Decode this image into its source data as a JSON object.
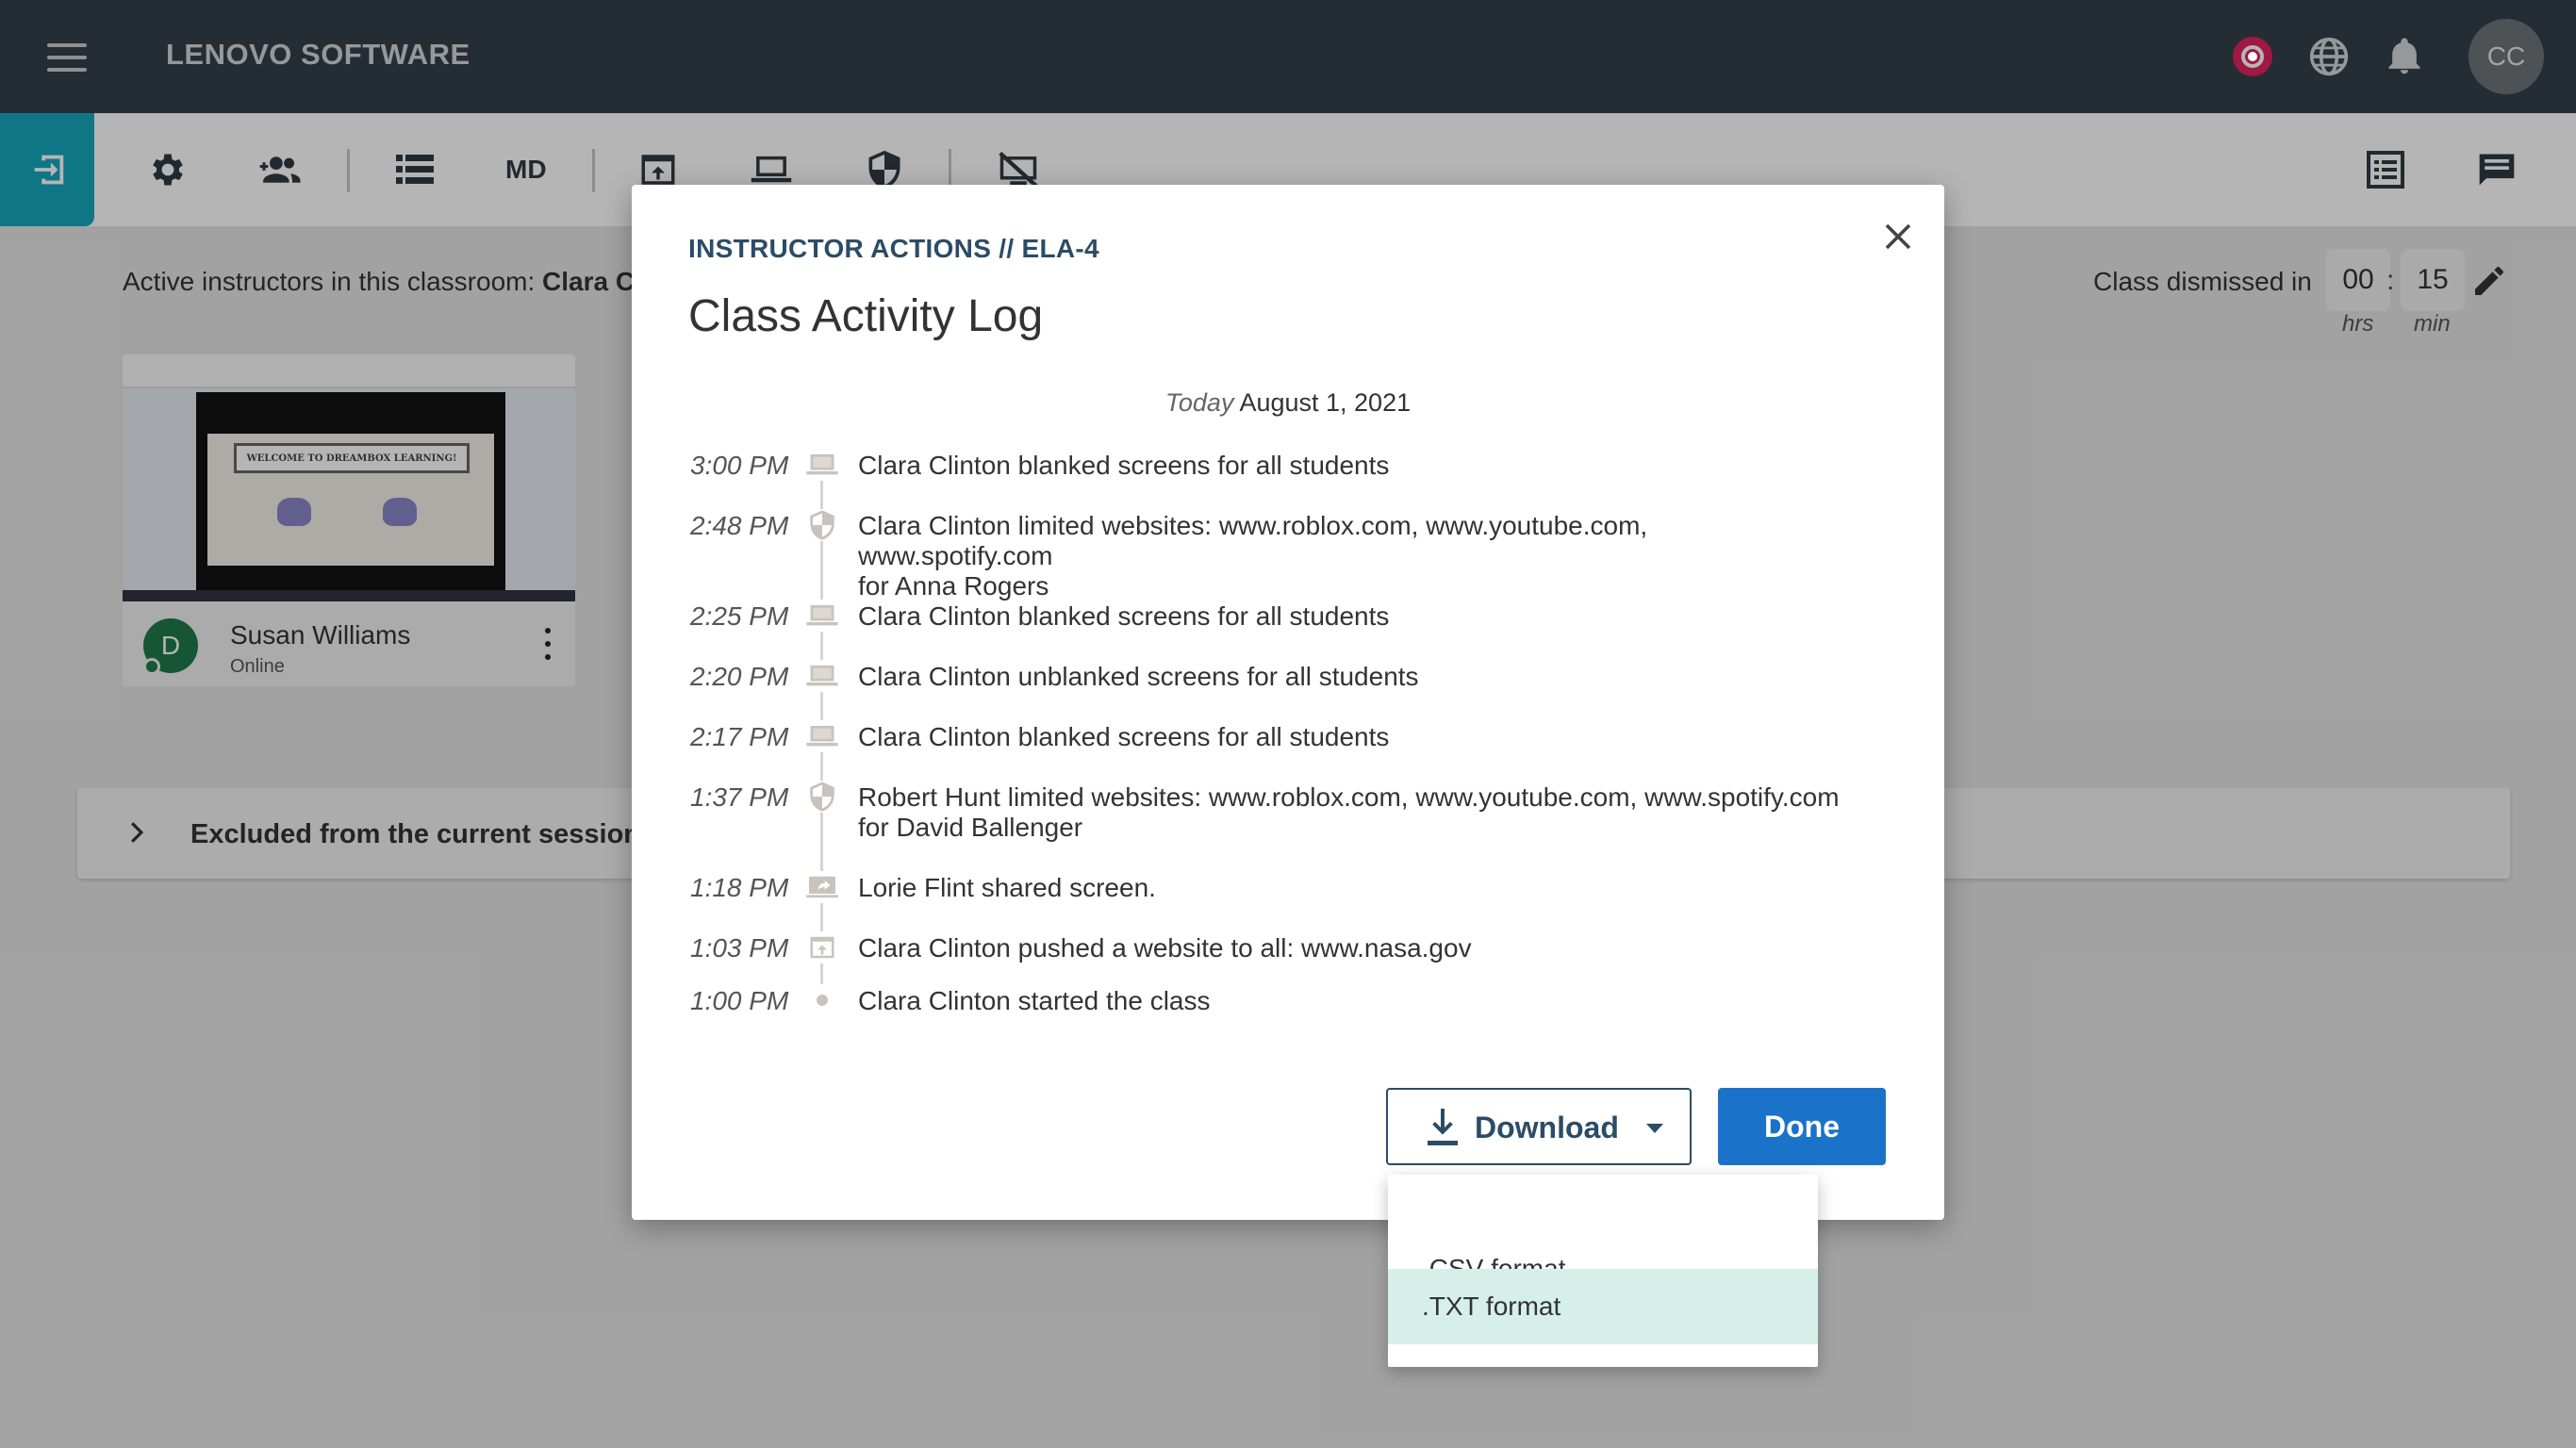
{
  "app": {
    "brand": "LENOVO SOFTWARE",
    "user_initials": "CC"
  },
  "toolbar": {
    "md_label": "MD"
  },
  "classroom": {
    "active_instructors_label": "Active instructors in this classroom:",
    "active_instructors_value": "Clara C",
    "dismiss_label": "Class dismissed in",
    "hours": "00",
    "minutes": "15",
    "hours_unit": "hrs",
    "minutes_unit": "min"
  },
  "student": {
    "initial": "D",
    "name": "Susan Williams",
    "status": "Online",
    "thumbnail_banner": "WELCOME TO DREAMBOX LEARNING!"
  },
  "excluded": {
    "label": "Excluded from the current session"
  },
  "modal": {
    "kicker": "INSTRUCTOR ACTIONS // ELA-4",
    "title": "Class Activity Log",
    "date_prefix": "Today",
    "date": "August 1, 2021",
    "log": [
      {
        "time": "3:00 PM",
        "icon": "laptop-icon",
        "text": "Clara Clinton blanked screens for all students"
      },
      {
        "time": "2:48 PM",
        "icon": "shield-icon",
        "text": "Clara Clinton limited websites: www.roblox.com, www.youtube.com, www.spotify.com",
        "text2": "for Anna Rogers"
      },
      {
        "time": "2:25 PM",
        "icon": "laptop-icon",
        "text": "Clara Clinton blanked screens for all students"
      },
      {
        "time": "2:20 PM",
        "icon": "laptop-icon",
        "text": "Clara Clinton unblanked screens for all students"
      },
      {
        "time": "2:17 PM",
        "icon": "laptop-icon",
        "text": "Clara Clinton blanked screens for all students"
      },
      {
        "time": "1:37 PM",
        "icon": "shield-icon",
        "text": "Robert Hunt limited websites: www.roblox.com, www.youtube.com, www.spotify.com",
        "text2": "for David Ballenger"
      },
      {
        "time": "1:18 PM",
        "icon": "share-screen-icon",
        "text": "Lorie Flint shared screen."
      },
      {
        "time": "1:03 PM",
        "icon": "push-website-icon",
        "text": "Clara Clinton pushed a website to all: www.nasa.gov"
      },
      {
        "time": "1:00 PM",
        "icon": "dot-icon",
        "text": "Clara Clinton started the class"
      }
    ],
    "download_label": "Download",
    "done_label": "Done",
    "download_options": [
      ".CSV format",
      ".TXT format"
    ],
    "selected_option": ".TXT format"
  },
  "colors": {
    "topbar": "#34404a",
    "accent_teal": "#16a7bd",
    "primary_blue": "#1a73c8",
    "kicker_navy": "#2c4c66",
    "record_red": "#e0245e",
    "selected_option_bg": "#d6efe9"
  }
}
